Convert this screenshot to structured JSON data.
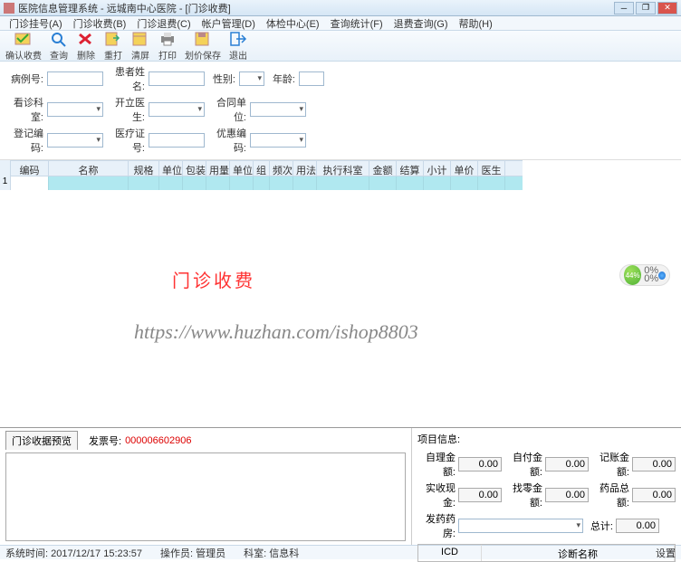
{
  "title": "医院信息管理系统 - 远城南中心医院 - [门诊收费]",
  "menus": [
    "门诊挂号(A)",
    "门诊收费(B)",
    "门诊退费(C)",
    "帐户管理(D)",
    "体检中心(E)",
    "查询统计(F)",
    "退费查询(G)",
    "帮助(H)"
  ],
  "toolbar": [
    {
      "label": "确认收费",
      "color": "#e6b400"
    },
    {
      "label": "查询",
      "color": "#2a7fd4"
    },
    {
      "label": "删除",
      "color": "#d23"
    },
    {
      "label": "重打",
      "color": "#e6b400"
    },
    {
      "label": "清屏",
      "color": "#e6b400"
    },
    {
      "label": "打印",
      "color": "#555"
    },
    {
      "label": "划价保存",
      "color": "#e6b400"
    },
    {
      "label": "退出",
      "color": "#2a7fd4"
    }
  ],
  "form": {
    "r1": {
      "l1": "病例号:",
      "l2": "患者姓名:",
      "l3": "性别:",
      "l4": "年龄:"
    },
    "r2": {
      "l1": "看诊科室:",
      "l2": "开立医生:",
      "l3": "合同单位:"
    },
    "r3": {
      "l1": "登记编码:",
      "l2": "医疗证号:",
      "l3": "优惠编码:"
    }
  },
  "columns": [
    "编码",
    "名称",
    "规格",
    "单位",
    "包装",
    "用量",
    "单位",
    "组",
    "频次",
    "用法",
    "执行科室",
    "金额",
    "结算",
    "小计",
    "单价",
    "医生"
  ],
  "row1": "1",
  "bigred": "门诊收费",
  "watermark": "https://www.huzhan.com/ishop8803",
  "gauge": "44%",
  "g0": "0%",
  "g1": "0%",
  "tab": "门诊收据预览",
  "invlbl": "发票号:",
  "invnum": "000006602906",
  "projinfo": "项目信息:",
  "sums": {
    "r1": {
      "l1": "自理金额:",
      "v1": "0.00",
      "l2": "自付金额:",
      "v2": "0.00",
      "l3": "记账金额:",
      "v3": "0.00"
    },
    "r2": {
      "l1": "实收现金:",
      "v1": "0.00",
      "l2": "找零金额:",
      "v2": "0.00",
      "l3": "药品总额:",
      "v3": "0.00"
    },
    "r3": {
      "l1": "发药药房:",
      "l2": "总计:",
      "v2": "0.00"
    }
  },
  "tbl2": {
    "c1": "ICD",
    "c2": "诊断名称"
  },
  "status": {
    "time": "系统时间: 2017/12/17 15:23:57",
    "op": "操作员: 管理员",
    "dept": "科室: 信息科",
    "set": "设置"
  }
}
